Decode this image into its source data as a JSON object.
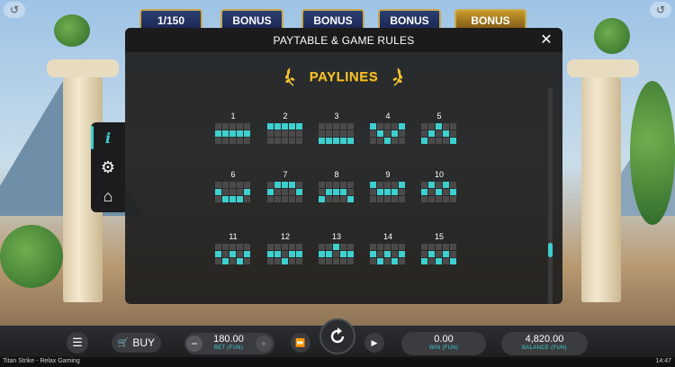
{
  "top": {
    "counter": "1/150",
    "bonus_labels": [
      "BONUS",
      "BONUS",
      "BONUS",
      "BONUS"
    ]
  },
  "side_panel": {
    "items": [
      {
        "name": "info",
        "icon": "info-icon",
        "glyph": "i"
      },
      {
        "name": "settings",
        "icon": "gear-icon",
        "glyph": "⚙"
      },
      {
        "name": "home",
        "icon": "home-icon",
        "glyph": "⌂"
      }
    ]
  },
  "modal": {
    "title": "PAYTABLE & GAME RULES",
    "close_glyph": "✕",
    "section_title": "PAYLINES",
    "paylines": [
      {
        "number": "1",
        "pattern": [
          [
            0,
            0,
            0,
            0,
            0
          ],
          [
            1,
            1,
            1,
            1,
            1
          ],
          [
            0,
            0,
            0,
            0,
            0
          ]
        ]
      },
      {
        "number": "2",
        "pattern": [
          [
            1,
            1,
            1,
            1,
            1
          ],
          [
            0,
            0,
            0,
            0,
            0
          ],
          [
            0,
            0,
            0,
            0,
            0
          ]
        ]
      },
      {
        "number": "3",
        "pattern": [
          [
            0,
            0,
            0,
            0,
            0
          ],
          [
            0,
            0,
            0,
            0,
            0
          ],
          [
            1,
            1,
            1,
            1,
            1
          ]
        ]
      },
      {
        "number": "4",
        "pattern": [
          [
            1,
            0,
            0,
            0,
            1
          ],
          [
            0,
            1,
            0,
            1,
            0
          ],
          [
            0,
            0,
            1,
            0,
            0
          ]
        ]
      },
      {
        "number": "5",
        "pattern": [
          [
            0,
            0,
            1,
            0,
            0
          ],
          [
            0,
            1,
            0,
            1,
            0
          ],
          [
            1,
            0,
            0,
            0,
            1
          ]
        ]
      },
      {
        "number": "6",
        "pattern": [
          [
            0,
            0,
            0,
            0,
            0
          ],
          [
            1,
            0,
            0,
            0,
            1
          ],
          [
            0,
            1,
            1,
            1,
            0
          ]
        ]
      },
      {
        "number": "7",
        "pattern": [
          [
            0,
            1,
            1,
            1,
            0
          ],
          [
            1,
            0,
            0,
            0,
            1
          ],
          [
            0,
            0,
            0,
            0,
            0
          ]
        ]
      },
      {
        "number": "8",
        "pattern": [
          [
            0,
            0,
            0,
            0,
            0
          ],
          [
            0,
            1,
            1,
            1,
            0
          ],
          [
            1,
            0,
            0,
            0,
            1
          ]
        ]
      },
      {
        "number": "9",
        "pattern": [
          [
            1,
            0,
            0,
            0,
            1
          ],
          [
            0,
            1,
            1,
            1,
            0
          ],
          [
            0,
            0,
            0,
            0,
            0
          ]
        ]
      },
      {
        "number": "10",
        "pattern": [
          [
            0,
            1,
            0,
            1,
            0
          ],
          [
            1,
            0,
            1,
            0,
            1
          ],
          [
            0,
            0,
            0,
            0,
            0
          ]
        ]
      },
      {
        "number": "11",
        "pattern": [
          [
            0,
            0,
            0,
            0,
            0
          ],
          [
            1,
            0,
            1,
            0,
            1
          ],
          [
            0,
            1,
            0,
            1,
            0
          ]
        ]
      },
      {
        "number": "12",
        "pattern": [
          [
            0,
            0,
            0,
            0,
            0
          ],
          [
            1,
            1,
            0,
            1,
            1
          ],
          [
            0,
            0,
            1,
            0,
            0
          ]
        ]
      },
      {
        "number": "13",
        "pattern": [
          [
            0,
            0,
            1,
            0,
            0
          ],
          [
            1,
            1,
            0,
            1,
            1
          ],
          [
            0,
            0,
            0,
            0,
            0
          ]
        ]
      },
      {
        "number": "14",
        "pattern": [
          [
            0,
            0,
            0,
            0,
            0
          ],
          [
            1,
            0,
            1,
            0,
            1
          ],
          [
            0,
            1,
            0,
            1,
            0
          ]
        ]
      },
      {
        "number": "15",
        "pattern": [
          [
            0,
            0,
            0,
            0,
            0
          ],
          [
            0,
            1,
            0,
            1,
            0
          ],
          [
            1,
            0,
            1,
            0,
            1
          ]
        ]
      }
    ]
  },
  "bottom_bar": {
    "buy_label": "BUY",
    "bet_value": "180.00",
    "bet_label": "BET (FUN)",
    "win_value": "0.00",
    "win_label": "WIN (FUN)",
    "balance_value": "4,820.00",
    "balance_label": "BALANCE (FUN)"
  },
  "status": {
    "game_name": "Titan Strike - Relax Gaming",
    "clock": "14:47"
  },
  "colors": {
    "accent": "#3ed0d0",
    "gold": "#f2c230",
    "modal_bg": "#1e1e1e"
  }
}
